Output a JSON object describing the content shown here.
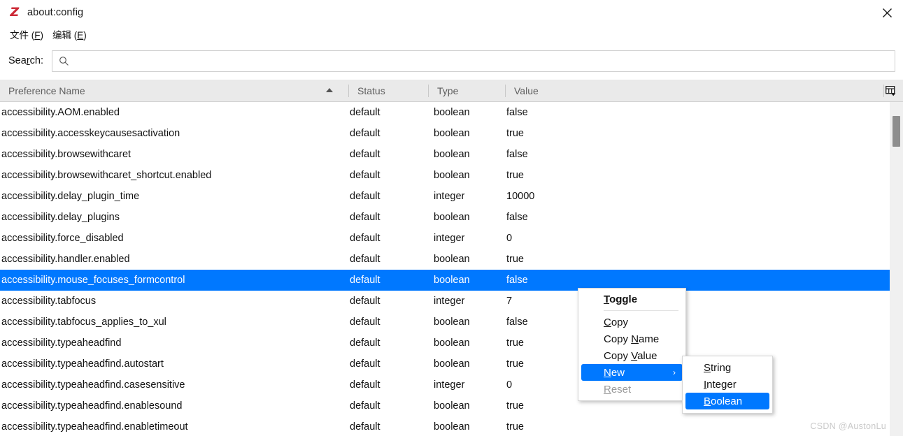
{
  "window": {
    "title": "about:config",
    "logo_glyph": "Z",
    "logo_color": "#cc2936",
    "close_icon": "close-icon"
  },
  "menubar": {
    "items": [
      {
        "prefix": "文件 (",
        "accesskey": "F",
        "suffix": ")"
      },
      {
        "prefix": "编辑 (",
        "accesskey": "E",
        "suffix": ")"
      }
    ]
  },
  "search": {
    "label_before": "Sea",
    "label_accesskey": "r",
    "label_after": "ch:",
    "value": "",
    "placeholder": "",
    "icon": "search-icon"
  },
  "table": {
    "columns": [
      {
        "label": "Preference Name",
        "sorted": "asc"
      },
      {
        "label": "Status"
      },
      {
        "label": "Type"
      },
      {
        "label": "Value"
      }
    ],
    "column_picker_icon": "column-picker-icon",
    "rows": [
      {
        "name": "accessibility.AOM.enabled",
        "status": "default",
        "type": "boolean",
        "value": "false",
        "selected": false
      },
      {
        "name": "accessibility.accesskeycausesactivation",
        "status": "default",
        "type": "boolean",
        "value": "true",
        "selected": false
      },
      {
        "name": "accessibility.browsewithcaret",
        "status": "default",
        "type": "boolean",
        "value": "false",
        "selected": false
      },
      {
        "name": "accessibility.browsewithcaret_shortcut.enabled",
        "status": "default",
        "type": "boolean",
        "value": "true",
        "selected": false
      },
      {
        "name": "accessibility.delay_plugin_time",
        "status": "default",
        "type": "integer",
        "value": "10000",
        "selected": false
      },
      {
        "name": "accessibility.delay_plugins",
        "status": "default",
        "type": "boolean",
        "value": "false",
        "selected": false
      },
      {
        "name": "accessibility.force_disabled",
        "status": "default",
        "type": "integer",
        "value": "0",
        "selected": false
      },
      {
        "name": "accessibility.handler.enabled",
        "status": "default",
        "type": "boolean",
        "value": "true",
        "selected": false
      },
      {
        "name": "accessibility.mouse_focuses_formcontrol",
        "status": "default",
        "type": "boolean",
        "value": "false",
        "selected": true
      },
      {
        "name": "accessibility.tabfocus",
        "status": "default",
        "type": "integer",
        "value": "7",
        "selected": false
      },
      {
        "name": "accessibility.tabfocus_applies_to_xul",
        "status": "default",
        "type": "boolean",
        "value": "false",
        "selected": false
      },
      {
        "name": "accessibility.typeaheadfind",
        "status": "default",
        "type": "boolean",
        "value": "true",
        "selected": false
      },
      {
        "name": "accessibility.typeaheadfind.autostart",
        "status": "default",
        "type": "boolean",
        "value": "true",
        "selected": false
      },
      {
        "name": "accessibility.typeaheadfind.casesensitive",
        "status": "default",
        "type": "integer",
        "value": "0",
        "selected": false
      },
      {
        "name": "accessibility.typeaheadfind.enablesound",
        "status": "default",
        "type": "boolean",
        "value": "true",
        "selected": false
      },
      {
        "name": "accessibility.typeaheadfind.enabletimeout",
        "status": "default",
        "type": "boolean",
        "value": "true",
        "selected": false
      }
    ]
  },
  "context_menu": {
    "items": [
      {
        "before": "",
        "accesskey": "T",
        "after": "oggle",
        "bold": true,
        "disabled": false,
        "highlight": false,
        "submenu": false,
        "separator_after": true
      },
      {
        "before": "",
        "accesskey": "C",
        "after": "opy",
        "bold": false,
        "disabled": false,
        "highlight": false,
        "submenu": false,
        "separator_after": false
      },
      {
        "before": "Copy ",
        "accesskey": "N",
        "after": "ame",
        "bold": false,
        "disabled": false,
        "highlight": false,
        "submenu": false,
        "separator_after": false
      },
      {
        "before": "Copy ",
        "accesskey": "V",
        "after": "alue",
        "bold": false,
        "disabled": false,
        "highlight": false,
        "submenu": false,
        "separator_after": false
      },
      {
        "before": "",
        "accesskey": "N",
        "after": "ew",
        "bold": false,
        "disabled": false,
        "highlight": true,
        "submenu": true,
        "separator_after": false
      },
      {
        "before": "",
        "accesskey": "R",
        "after": "eset",
        "bold": false,
        "disabled": true,
        "highlight": false,
        "submenu": false,
        "separator_after": false
      }
    ],
    "submenu_arrow": "chevron-right-icon"
  },
  "submenu": {
    "items": [
      {
        "accesskey": "S",
        "after": "tring",
        "highlight": false
      },
      {
        "accesskey": "I",
        "after": "nteger",
        "highlight": false
      },
      {
        "accesskey": "B",
        "after": "oolean",
        "highlight": true
      }
    ]
  },
  "watermark": {
    "text": "CSDN @AustonLu"
  },
  "colors": {
    "accent": "#0078ff",
    "header_bg": "#eaeaea",
    "logo": "#cc2936"
  }
}
